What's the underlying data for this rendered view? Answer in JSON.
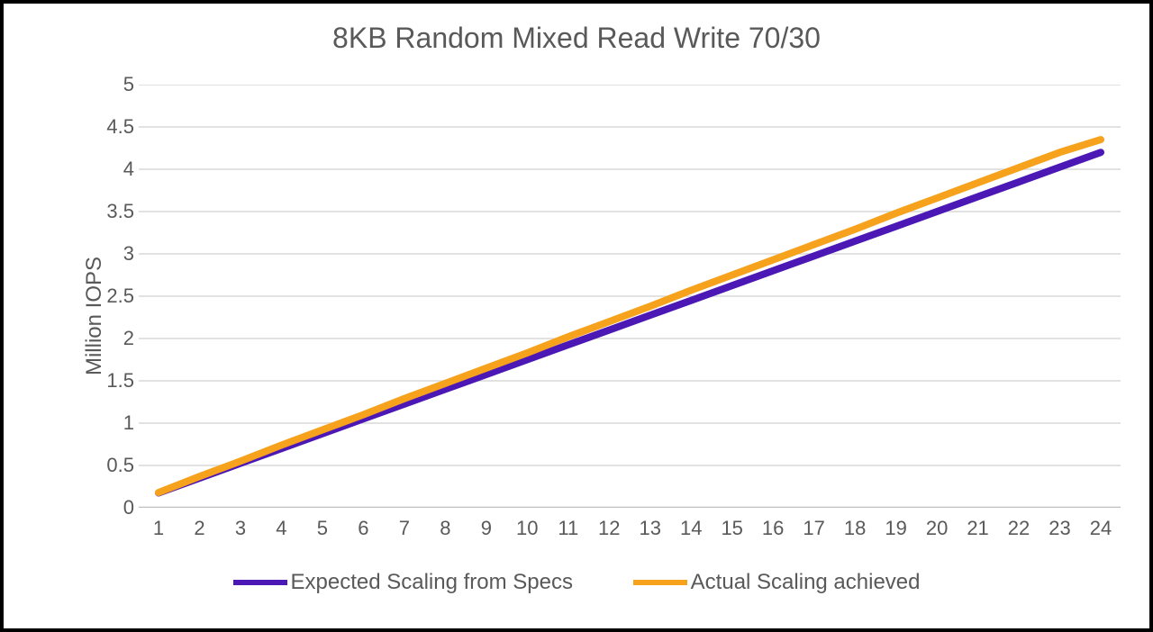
{
  "chart_data": {
    "type": "line",
    "title": "8KB Random Mixed Read Write 70/30",
    "ylabel": "Million IOPS",
    "xlabel": "",
    "ylim": [
      0,
      5
    ],
    "yticks": [
      0,
      0.5,
      1,
      1.5,
      2,
      2.5,
      3,
      3.5,
      4,
      4.5,
      5
    ],
    "categories": [
      1,
      2,
      3,
      4,
      5,
      6,
      7,
      8,
      9,
      10,
      11,
      12,
      13,
      14,
      15,
      16,
      17,
      18,
      19,
      20,
      21,
      22,
      23,
      24
    ],
    "series": [
      {
        "name": "Expected Scaling from Specs",
        "color": "#4b17b5",
        "values": [
          0.175,
          0.35,
          0.525,
          0.7,
          0.875,
          1.05,
          1.225,
          1.4,
          1.575,
          1.75,
          1.925,
          2.1,
          2.275,
          2.45,
          2.625,
          2.8,
          2.975,
          3.15,
          3.325,
          3.5,
          3.675,
          3.85,
          4.025,
          4.2
        ]
      },
      {
        "name": "Actual Scaling achieved",
        "color": "#f6a21d",
        "values": [
          0.18,
          0.37,
          0.55,
          0.74,
          0.92,
          1.1,
          1.29,
          1.47,
          1.65,
          1.83,
          2.02,
          2.2,
          2.38,
          2.57,
          2.75,
          2.93,
          3.11,
          3.29,
          3.48,
          3.66,
          3.84,
          4.02,
          4.2,
          4.35
        ]
      }
    ]
  }
}
